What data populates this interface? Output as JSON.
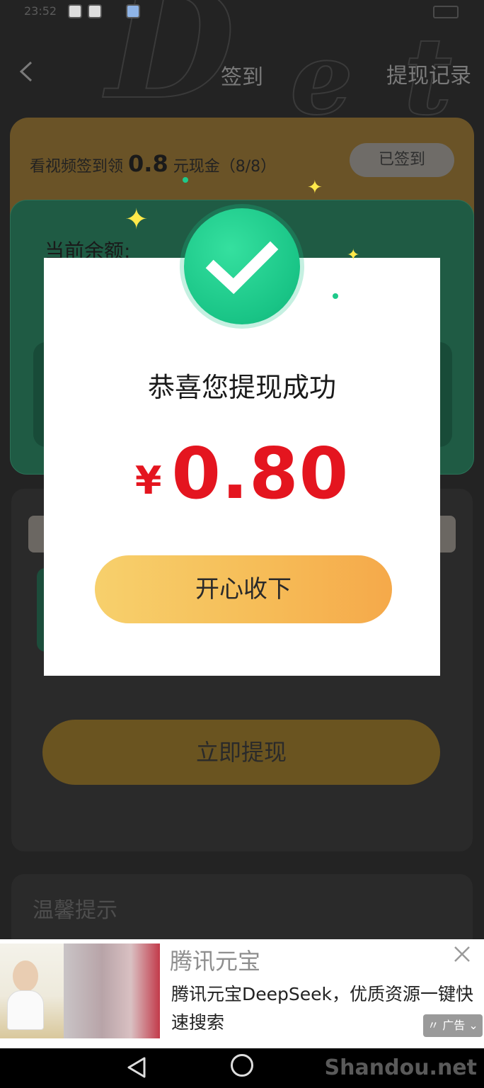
{
  "status_bar": {
    "time": "23:52"
  },
  "header": {
    "title": "签到",
    "right_link": "提现记录"
  },
  "checkin": {
    "prefix": "看视频签到领",
    "amount": "0.8",
    "suffix": "元现金（8/8）",
    "status_button": "已签到"
  },
  "balance": {
    "label": "当前余额:"
  },
  "withdraw_button": "立即提现",
  "tips": {
    "title": "温馨提示"
  },
  "modal": {
    "title": "恭喜您提现成功",
    "currency": "¥",
    "amount": "0.80",
    "accept_button": "开心收下"
  },
  "ad": {
    "title": "腾讯元宝",
    "description": "腾讯元宝DeepSeek，优质资源一键快速搜索",
    "badge": "广告",
    "badge_icon": "sound-wave-icon",
    "close_icon": "close-icon"
  },
  "watermark": "Shandou.net",
  "colors": {
    "success_green": "#19c486",
    "amount_red": "#e4151f",
    "button_yellow": "#f6bd58"
  }
}
